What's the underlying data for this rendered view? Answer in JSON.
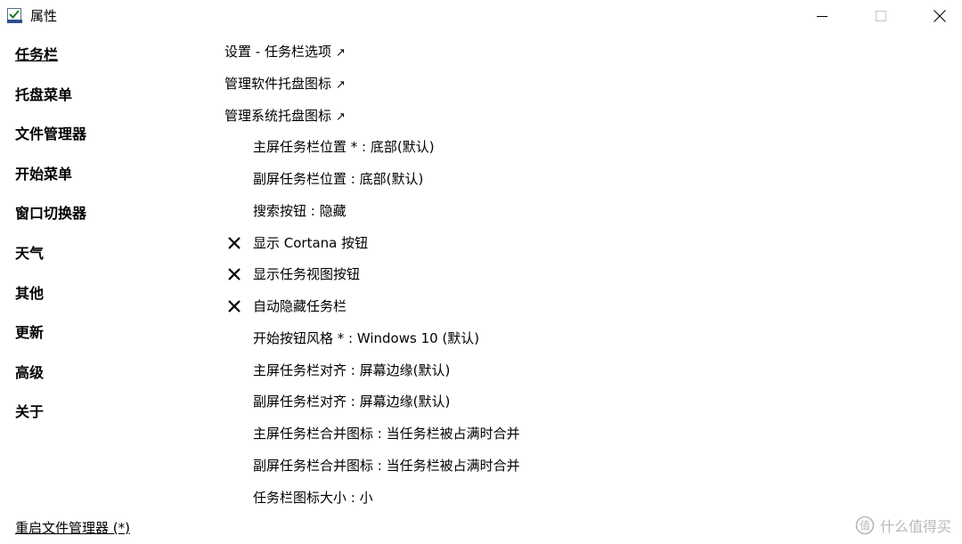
{
  "window": {
    "title": "属性",
    "icon": "checkbox-app-icon"
  },
  "sidebar": {
    "items": [
      {
        "label": "任务栏",
        "active": true
      },
      {
        "label": "托盘菜单"
      },
      {
        "label": "文件管理器"
      },
      {
        "label": "开始菜单"
      },
      {
        "label": "窗口切换器"
      },
      {
        "label": "天气"
      },
      {
        "label": "其他"
      },
      {
        "label": "更新"
      },
      {
        "label": "高级"
      },
      {
        "label": "关于"
      }
    ],
    "restart_link": "重启文件管理器 (*)"
  },
  "content": {
    "links": [
      {
        "label": "设置 - 任务栏选项",
        "arrow": "↗"
      },
      {
        "label": "管理软件托盘图标",
        "arrow": "↗"
      },
      {
        "label": "管理系统托盘图标",
        "arrow": "↗"
      }
    ],
    "settings": [
      {
        "label": "主屏任务栏位置 * : 底部(默认)",
        "checked": false
      },
      {
        "label": "副屏任务栏位置 : 底部(默认)",
        "checked": false
      },
      {
        "label": "搜索按钮 : 隐藏",
        "checked": false
      },
      {
        "label": "显示 Cortana 按钮",
        "checked": true
      },
      {
        "label": "显示任务视图按钮",
        "checked": true
      },
      {
        "label": "自动隐藏任务栏",
        "checked": true
      },
      {
        "label": "开始按钮风格 * : Windows 10 (默认)",
        "checked": false
      },
      {
        "label": "主屏任务栏对齐 : 屏幕边缘(默认)",
        "checked": false
      },
      {
        "label": "副屏任务栏对齐 : 屏幕边缘(默认)",
        "checked": false
      },
      {
        "label": "主屏任务栏合并图标 : 当任务栏被占满时合并",
        "checked": false
      },
      {
        "label": "副屏任务栏合并图标 : 当任务栏被占满时合并",
        "checked": false
      },
      {
        "label": "任务栏图标大小 : 小",
        "checked": false
      }
    ]
  },
  "watermark": {
    "text": "什么值得买"
  }
}
